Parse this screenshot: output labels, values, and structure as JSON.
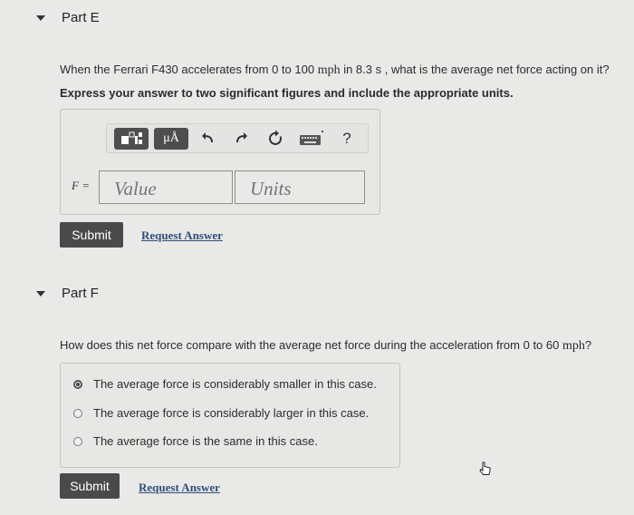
{
  "part_e": {
    "title": "Part E",
    "question_pre": "When the Ferrari F430 accelerates from 0 to 100 ",
    "question_unit1": "mph",
    "question_mid": " in 8.3  s , what is the average net force acting on it?",
    "instruction": "Express your answer to two significant figures and include the appropriate units.",
    "toolbar": {
      "units_label": "μÅ",
      "help_label": "?"
    },
    "variable_label": "F =",
    "value_placeholder": "Value",
    "units_placeholder": "Units",
    "submit_label": "Submit",
    "request_answer_label": "Request Answer"
  },
  "part_f": {
    "title": "Part F",
    "question_pre": "How does this net force compare with the average net force during the acceleration from 0 to 60 ",
    "question_unit": "mph",
    "question_post": "?",
    "choices": [
      {
        "label": "The average force is considerably smaller in this case.",
        "selected": true
      },
      {
        "label": "The average force is considerably larger in this case.",
        "selected": false
      },
      {
        "label": "The average force is the same in this case.",
        "selected": false
      }
    ],
    "submit_label": "Submit",
    "request_answer_label": "Request Answer"
  }
}
